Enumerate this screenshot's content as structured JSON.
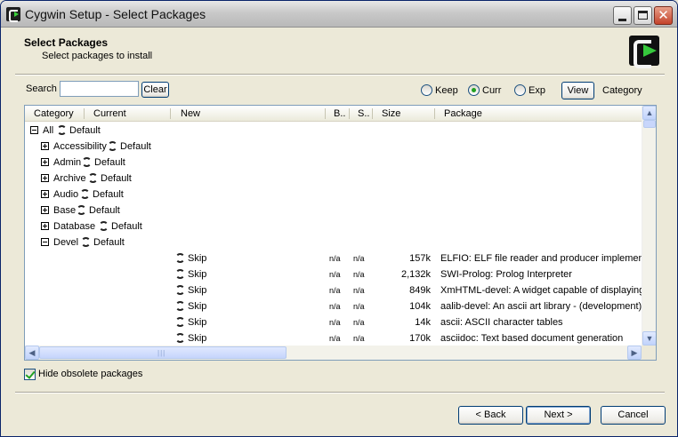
{
  "window": {
    "title": "Cygwin Setup - Select Packages"
  },
  "header": {
    "title": "Select Packages",
    "subtitle": "Select packages to install"
  },
  "search": {
    "label": "Search",
    "value": "",
    "clear_label": "Clear"
  },
  "view_options": {
    "keep": "Keep",
    "curr": "Curr",
    "exp": "Exp",
    "selected": "Curr",
    "view_label": "View",
    "view_mode": "Category"
  },
  "columns": {
    "category": "Category",
    "current": "Current",
    "new": "New",
    "bin": "B..",
    "src": "S..",
    "size": "Size",
    "package": "Package"
  },
  "categories": [
    {
      "name": "All",
      "action": "Default",
      "level": 0,
      "expanded": true
    },
    {
      "name": "Accessibility",
      "action": "Default",
      "level": 1,
      "expanded": false
    },
    {
      "name": "Admin",
      "action": "Default",
      "level": 1,
      "expanded": false
    },
    {
      "name": "Archive",
      "action": "Default",
      "level": 1,
      "expanded": false
    },
    {
      "name": "Audio",
      "action": "Default",
      "level": 1,
      "expanded": false
    },
    {
      "name": "Base",
      "action": "Default",
      "level": 1,
      "expanded": false
    },
    {
      "name": "Database",
      "action": "Default",
      "level": 1,
      "expanded": false
    },
    {
      "name": "Devel",
      "action": "Default",
      "level": 1,
      "expanded": true
    }
  ],
  "packages": [
    {
      "new": "Skip",
      "bin": "n/a",
      "src": "n/a",
      "size": "157k",
      "name": "ELFIO: ELF file reader and producer implemente"
    },
    {
      "new": "Skip",
      "bin": "n/a",
      "src": "n/a",
      "size": "2,132k",
      "name": "SWI-Prolog: Prolog Interpreter"
    },
    {
      "new": "Skip",
      "bin": "n/a",
      "src": "n/a",
      "size": "849k",
      "name": "XmHTML-devel: A widget capable of displaying"
    },
    {
      "new": "Skip",
      "bin": "n/a",
      "src": "n/a",
      "size": "104k",
      "name": "aalib-devel: An ascii art library - (development)"
    },
    {
      "new": "Skip",
      "bin": "n/a",
      "src": "n/a",
      "size": "14k",
      "name": "ascii: ASCII character tables"
    },
    {
      "new": "Skip",
      "bin": "n/a",
      "src": "n/a",
      "size": "170k",
      "name": "asciidoc: Text based document generation"
    }
  ],
  "options": {
    "hide_obsolete_label": "Hide obsolete packages",
    "hide_obsolete_checked": true
  },
  "footer": {
    "back_label": "< Back",
    "next_label": "Next >",
    "cancel_label": "Cancel"
  }
}
